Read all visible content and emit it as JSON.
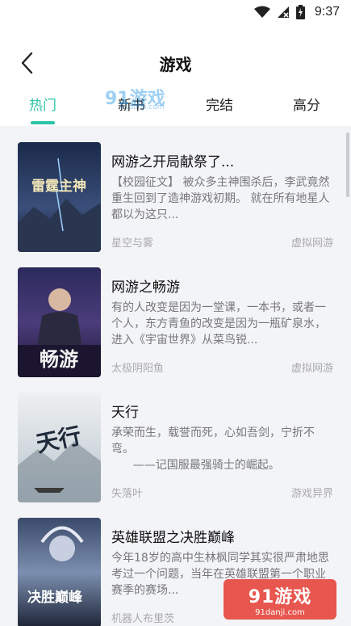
{
  "status_bar": {
    "time": "9:37"
  },
  "header": {
    "title": "游戏"
  },
  "tabs": [
    {
      "label": "热门",
      "active": true
    },
    {
      "label": "新书",
      "active": false
    },
    {
      "label": "完结",
      "active": false
    },
    {
      "label": "高分",
      "active": false
    }
  ],
  "watermark_top": {
    "text": "91游戏",
    "sub": "91danji.com"
  },
  "books": [
    {
      "title": "网游之开局献祭了...",
      "description": "【校园征文】   被众多主神围杀后，李武竟然重生回到了造神游戏初期。   就在所有地星人都以为这只...",
      "author": "星空与雾",
      "tag": "虚拟网游",
      "cover_text": "雷霆主神"
    },
    {
      "title": "网游之畅游",
      "description": "有的人改变是因为一堂课，一本书，或者一个人，东方青鱼的改变是因为一瓶矿泉水，进入《宇宙世界》从菜鸟锐...",
      "author": "太极阴阳鱼",
      "tag": "虚拟网游",
      "cover_text": "畅游"
    },
    {
      "title": "天行",
      "description": "承荣而生，载誉而死，心如吾剑，宁折不弯。\n      ——记国服最强骑士的崛起。",
      "author": "失落叶",
      "tag": "游戏异界",
      "cover_text": "天行"
    },
    {
      "title": "英雄联盟之决胜巅峰",
      "description": "今年18岁的高中生林枫同学其实很严肃地思考过一个问题，当年在英雄联盟第一个职业赛季的赛场...",
      "author": "机器人布里茨",
      "tag": "",
      "cover_text": "决胜巅峰"
    }
  ],
  "watermark_bottom": {
    "text": "91游戏",
    "sub": "91danji.com"
  }
}
